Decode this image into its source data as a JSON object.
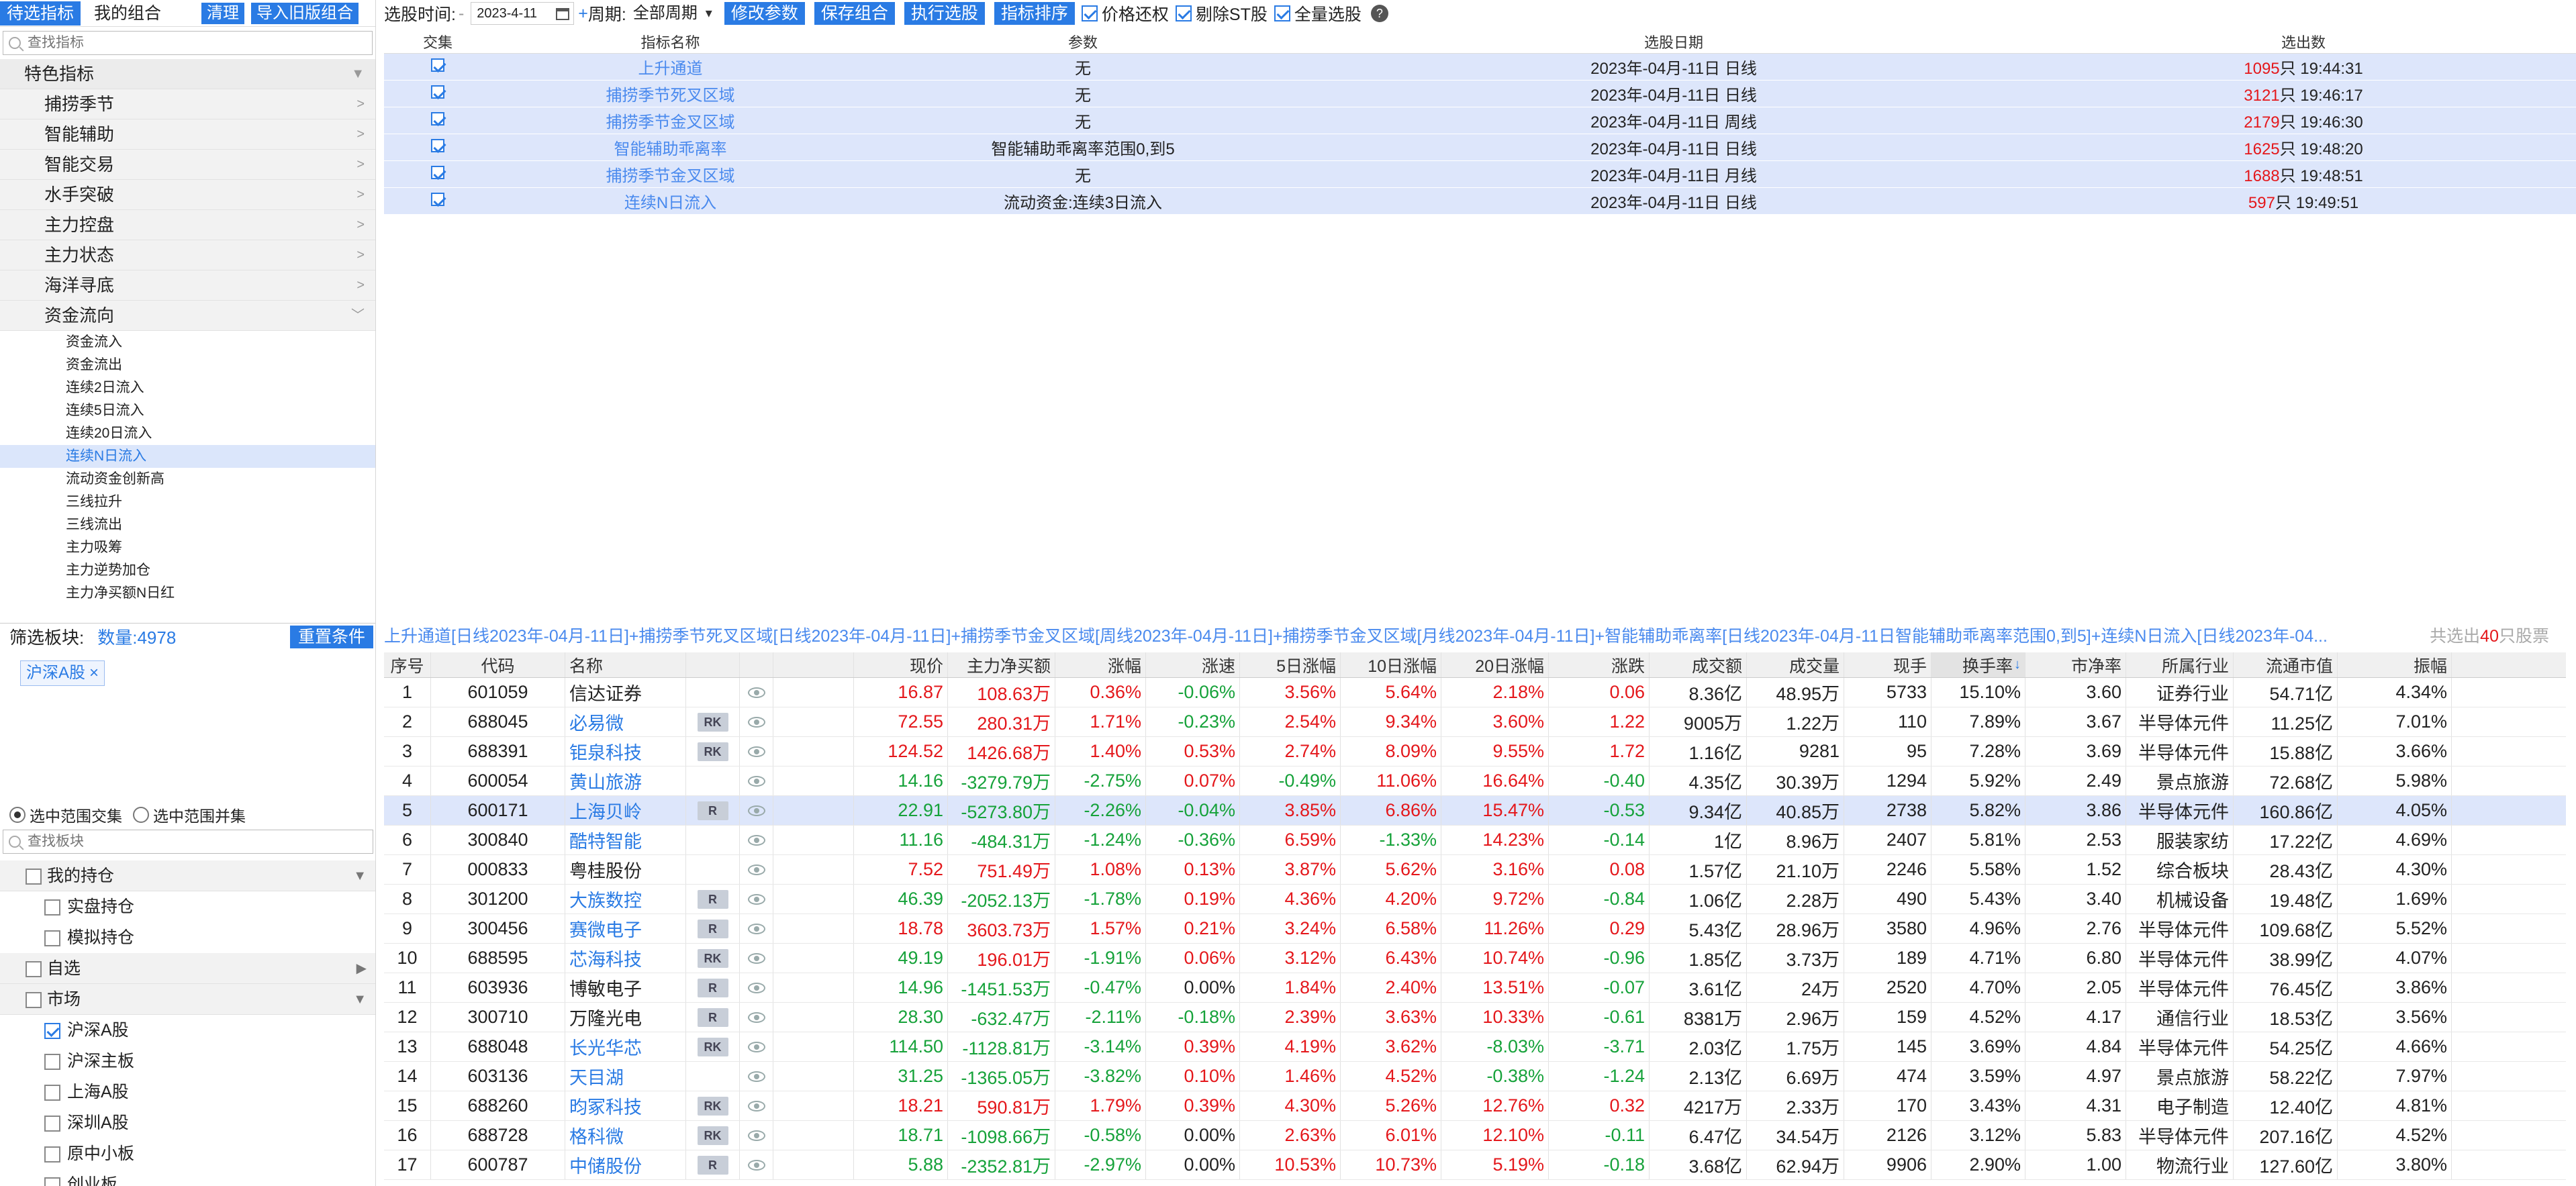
{
  "left_panel": {
    "tabs": [
      "待选指标",
      "我的组合"
    ],
    "buttons": {
      "clear": "清理",
      "import": "导入旧版组合"
    },
    "search_placeholder": "查找指标",
    "group_label": "特色指标",
    "categories": [
      "捕捞季节",
      "智能辅助",
      "智能交易",
      "水手突破",
      "主力控盘",
      "主力状态",
      "海洋寻底",
      "资金流向"
    ],
    "leaves": [
      "资金流入",
      "资金流出",
      "连续2日流入",
      "连续5日流入",
      "连续20日流入",
      "连续N日流入",
      "流动资金创新高",
      "三线拉升",
      "三线流出",
      "主力吸筹",
      "主力逆势加仓",
      "主力净买额N日红"
    ],
    "filter": {
      "label": "筛选板块:",
      "count": "数量:4978",
      "reset": "重置条件"
    },
    "chip": "沪深A股",
    "radios": [
      "选中范围交集",
      "选中范围并集"
    ],
    "board_search_placeholder": "查找板块",
    "market_tree": {
      "my_hold": "我的持仓",
      "hold_items": [
        "实盘持仓",
        "模拟持仓"
      ],
      "fav": "自选",
      "market": "市场",
      "market_items": [
        "沪深A股",
        "沪深主板",
        "上海A股",
        "深圳A股",
        "原中小板",
        "创业板"
      ]
    }
  },
  "toolbar": {
    "time_label": "选股时间:",
    "date_value": "2023-4-11",
    "period_label": "周期:",
    "period_value": "全部周期",
    "buttons": [
      "修改参数",
      "保存组合",
      "执行选股",
      "指标排序"
    ],
    "checks": [
      "价格还权",
      "剔除ST股",
      "全量选股"
    ],
    "help": "?"
  },
  "upper_table": {
    "headers": [
      "交集",
      "指标名称",
      "参数",
      "选股日期",
      "选出数"
    ],
    "rows": [
      {
        "name": "上升通道",
        "param": "无",
        "date": "2023年-04月-11日 日线",
        "count": "1095",
        "suffix": "只 19:44:31"
      },
      {
        "name": "捕捞季节死叉区域",
        "param": "无",
        "date": "2023年-04月-11日 日线",
        "count": "3121",
        "suffix": "只 19:46:17"
      },
      {
        "name": "捕捞季节金叉区域",
        "param": "无",
        "date": "2023年-04月-11日 周线",
        "count": "2179",
        "suffix": "只 19:46:30"
      },
      {
        "name": "智能辅助乖离率",
        "param": "智能辅助乖离率范围0,到5",
        "date": "2023年-04月-11日 日线",
        "count": "1625",
        "suffix": "只 19:48:20"
      },
      {
        "name": "捕捞季节金叉区域",
        "param": "无",
        "date": "2023年-04月-11日 月线",
        "count": "1688",
        "suffix": "只 19:48:51"
      },
      {
        "name": "连续N日流入",
        "param": "流动资金:连续3日流入",
        "date": "2023年-04月-11日 日线",
        "count": "597",
        "suffix": "只 19:49:51"
      }
    ]
  },
  "summary": {
    "text": "上升通道[日线2023年-04月-11日]+捕捞季节死叉区域[日线2023年-04月-11日]+捕捞季节金叉区域[周线2023年-04月-11日]+捕捞季节金叉区域[月线2023年-04月-11日]+智能辅助乖离率[日线2023年-04月-11日智能辅助乖离率范围0,到5]+连续N日流入[日线2023年-04...",
    "result_prefix": "共选出",
    "result_count": "40",
    "result_suffix": "只股票"
  },
  "lower_table": {
    "headers": [
      "序号",
      "代码",
      "名称",
      "",
      "",
      "",
      "现价",
      "主力净买额",
      "涨幅",
      "涨速",
      "5日涨幅",
      "10日涨幅",
      "20日涨幅",
      "涨跌",
      "成交额",
      "成交量",
      "现手",
      "换手率",
      "市净率",
      "所属行业",
      "流通市值",
      "振幅"
    ],
    "sort_indicator": "↓",
    "rows": [
      {
        "seq": "1",
        "code": "601059",
        "name": "信达证券",
        "link": false,
        "tag": "",
        "price": "16.87",
        "main": "108.63万",
        "chg": "0.36%",
        "spd": "-0.06%",
        "d5": "3.56%",
        "d10": "5.64%",
        "d20": "2.18%",
        "zd": "0.06",
        "amt": "8.36亿",
        "vol": "48.95万",
        "hand": "5733",
        "tr": "15.10%",
        "pb": "3.60",
        "ind": "证券行业",
        "mv": "54.71亿",
        "amp": "4.34%"
      },
      {
        "seq": "2",
        "code": "688045",
        "name": "必易微",
        "link": true,
        "tag": "RK",
        "price": "72.55",
        "main": "280.31万",
        "chg": "1.71%",
        "spd": "-0.23%",
        "d5": "2.54%",
        "d10": "9.34%",
        "d20": "3.60%",
        "zd": "1.22",
        "amt": "9005万",
        "vol": "1.22万",
        "hand": "110",
        "tr": "7.89%",
        "pb": "3.67",
        "ind": "半导体元件",
        "mv": "11.25亿",
        "amp": "7.01%"
      },
      {
        "seq": "3",
        "code": "688391",
        "name": "钜泉科技",
        "link": true,
        "tag": "RK",
        "price": "124.52",
        "main": "1426.68万",
        "chg": "1.40%",
        "spd": "0.53%",
        "d5": "2.74%",
        "d10": "8.09%",
        "d20": "9.55%",
        "zd": "1.72",
        "amt": "1.16亿",
        "vol": "9281",
        "hand": "95",
        "tr": "7.28%",
        "pb": "3.69",
        "ind": "半导体元件",
        "mv": "15.88亿",
        "amp": "3.66%"
      },
      {
        "seq": "4",
        "code": "600054",
        "name": "黄山旅游",
        "link": true,
        "tag": "",
        "price": "14.16",
        "main": "-3279.79万",
        "chg": "-2.75%",
        "spd": "0.07%",
        "d5": "-0.49%",
        "d10": "11.06%",
        "d20": "16.64%",
        "zd": "-0.40",
        "amt": "4.35亿",
        "vol": "30.39万",
        "hand": "1294",
        "tr": "5.92%",
        "pb": "2.49",
        "ind": "景点旅游",
        "mv": "72.68亿",
        "amp": "5.98%"
      },
      {
        "seq": "5",
        "code": "600171",
        "name": "上海贝岭",
        "link": true,
        "tag": "R",
        "price": "22.91",
        "main": "-5273.80万",
        "chg": "-2.26%",
        "spd": "-0.04%",
        "d5": "3.85%",
        "d10": "6.86%",
        "d20": "15.47%",
        "zd": "-0.53",
        "amt": "9.34亿",
        "vol": "40.85万",
        "hand": "2738",
        "tr": "5.82%",
        "pb": "3.86",
        "ind": "半导体元件",
        "mv": "160.86亿",
        "amp": "4.05%"
      },
      {
        "seq": "6",
        "code": "300840",
        "name": "酷特智能",
        "link": true,
        "tag": "",
        "price": "11.16",
        "main": "-484.31万",
        "chg": "-1.24%",
        "spd": "-0.36%",
        "d5": "6.59%",
        "d10": "-1.33%",
        "d20": "14.23%",
        "zd": "-0.14",
        "amt": "1亿",
        "vol": "8.96万",
        "hand": "2407",
        "tr": "5.81%",
        "pb": "2.53",
        "ind": "服装家纺",
        "mv": "17.22亿",
        "amp": "4.69%"
      },
      {
        "seq": "7",
        "code": "000833",
        "name": "粤桂股份",
        "link": false,
        "tag": "",
        "price": "7.52",
        "main": "751.49万",
        "chg": "1.08%",
        "spd": "0.13%",
        "d5": "3.87%",
        "d10": "5.62%",
        "d20": "3.16%",
        "zd": "0.08",
        "amt": "1.57亿",
        "vol": "21.10万",
        "hand": "2246",
        "tr": "5.58%",
        "pb": "1.52",
        "ind": "综合板块",
        "mv": "28.43亿",
        "amp": "4.30%"
      },
      {
        "seq": "8",
        "code": "301200",
        "name": "大族数控",
        "link": true,
        "tag": "R",
        "price": "46.39",
        "main": "-2052.13万",
        "chg": "-1.78%",
        "spd": "0.19%",
        "d5": "4.36%",
        "d10": "4.20%",
        "d20": "9.72%",
        "zd": "-0.84",
        "amt": "1.06亿",
        "vol": "2.28万",
        "hand": "490",
        "tr": "5.43%",
        "pb": "3.40",
        "ind": "机械设备",
        "mv": "19.48亿",
        "amp": "1.69%"
      },
      {
        "seq": "9",
        "code": "300456",
        "name": "赛微电子",
        "link": true,
        "tag": "R",
        "price": "18.78",
        "main": "3603.73万",
        "chg": "1.57%",
        "spd": "0.21%",
        "d5": "3.24%",
        "d10": "6.58%",
        "d20": "11.26%",
        "zd": "0.29",
        "amt": "5.43亿",
        "vol": "28.96万",
        "hand": "3580",
        "tr": "4.96%",
        "pb": "2.76",
        "ind": "半导体元件",
        "mv": "109.68亿",
        "amp": "5.52%"
      },
      {
        "seq": "10",
        "code": "688595",
        "name": "芯海科技",
        "link": true,
        "tag": "RK",
        "price": "49.19",
        "main": "196.01万",
        "chg": "-1.91%",
        "spd": "0.06%",
        "d5": "3.12%",
        "d10": "6.43%",
        "d20": "10.74%",
        "zd": "-0.96",
        "amt": "1.85亿",
        "vol": "3.73万",
        "hand": "189",
        "tr": "4.71%",
        "pb": "6.80",
        "ind": "半导体元件",
        "mv": "38.99亿",
        "amp": "4.07%"
      },
      {
        "seq": "11",
        "code": "603936",
        "name": "博敏电子",
        "link": false,
        "tag": "R",
        "price": "14.96",
        "main": "-1451.53万",
        "chg": "-0.47%",
        "spd": "0.00%",
        "d5": "1.84%",
        "d10": "2.40%",
        "d20": "13.51%",
        "zd": "-0.07",
        "amt": "3.61亿",
        "vol": "24万",
        "hand": "2520",
        "tr": "4.70%",
        "pb": "2.05",
        "ind": "半导体元件",
        "mv": "76.45亿",
        "amp": "3.86%"
      },
      {
        "seq": "12",
        "code": "300710",
        "name": "万隆光电",
        "link": false,
        "tag": "R",
        "price": "28.30",
        "main": "-632.47万",
        "chg": "-2.11%",
        "spd": "-0.18%",
        "d5": "2.39%",
        "d10": "3.63%",
        "d20": "10.33%",
        "zd": "-0.61",
        "amt": "8381万",
        "vol": "2.96万",
        "hand": "159",
        "tr": "4.52%",
        "pb": "4.17",
        "ind": "通信行业",
        "mv": "18.53亿",
        "amp": "3.56%"
      },
      {
        "seq": "13",
        "code": "688048",
        "name": "长光华芯",
        "link": true,
        "tag": "RK",
        "price": "114.50",
        "main": "-1128.81万",
        "chg": "-3.14%",
        "spd": "0.39%",
        "d5": "4.19%",
        "d10": "3.62%",
        "d20": "-8.03%",
        "zd": "-3.71",
        "amt": "2.03亿",
        "vol": "1.75万",
        "hand": "145",
        "tr": "3.69%",
        "pb": "4.84",
        "ind": "半导体元件",
        "mv": "54.25亿",
        "amp": "4.66%"
      },
      {
        "seq": "14",
        "code": "603136",
        "name": "天目湖",
        "link": true,
        "tag": "",
        "price": "31.25",
        "main": "-1365.05万",
        "chg": "-3.82%",
        "spd": "0.10%",
        "d5": "1.46%",
        "d10": "4.52%",
        "d20": "-0.38%",
        "zd": "-1.24",
        "amt": "2.13亿",
        "vol": "6.69万",
        "hand": "474",
        "tr": "3.59%",
        "pb": "4.97",
        "ind": "景点旅游",
        "mv": "58.22亿",
        "amp": "7.97%"
      },
      {
        "seq": "15",
        "code": "688260",
        "name": "昀冢科技",
        "link": true,
        "tag": "RK",
        "price": "18.21",
        "main": "590.81万",
        "chg": "1.79%",
        "spd": "0.39%",
        "d5": "4.30%",
        "d10": "5.26%",
        "d20": "12.76%",
        "zd": "0.32",
        "amt": "4217万",
        "vol": "2.33万",
        "hand": "170",
        "tr": "3.43%",
        "pb": "4.31",
        "ind": "电子制造",
        "mv": "12.40亿",
        "amp": "4.81%"
      },
      {
        "seq": "16",
        "code": "688728",
        "name": "格科微",
        "link": true,
        "tag": "RK",
        "price": "18.71",
        "main": "-1098.66万",
        "chg": "-0.58%",
        "spd": "0.00%",
        "d5": "2.63%",
        "d10": "6.01%",
        "d20": "12.10%",
        "zd": "-0.11",
        "amt": "6.47亿",
        "vol": "34.54万",
        "hand": "2126",
        "tr": "3.12%",
        "pb": "5.83",
        "ind": "半导体元件",
        "mv": "207.16亿",
        "amp": "4.52%"
      },
      {
        "seq": "17",
        "code": "600787",
        "name": "中储股份",
        "link": true,
        "tag": "R",
        "price": "5.88",
        "main": "-2352.81万",
        "chg": "-2.97%",
        "spd": "0.00%",
        "d5": "10.53%",
        "d10": "10.73%",
        "d20": "5.19%",
        "zd": "-0.18",
        "amt": "3.68亿",
        "vol": "62.94万",
        "hand": "9906",
        "tr": "2.90%",
        "pb": "1.00",
        "ind": "物流行业",
        "mv": "127.60亿",
        "amp": "3.80%"
      }
    ]
  },
  "colors": {
    "accent": "#2a7be4",
    "up": "#e4171b",
    "down": "#16a23a",
    "row_highlight": "#dde6fb"
  }
}
